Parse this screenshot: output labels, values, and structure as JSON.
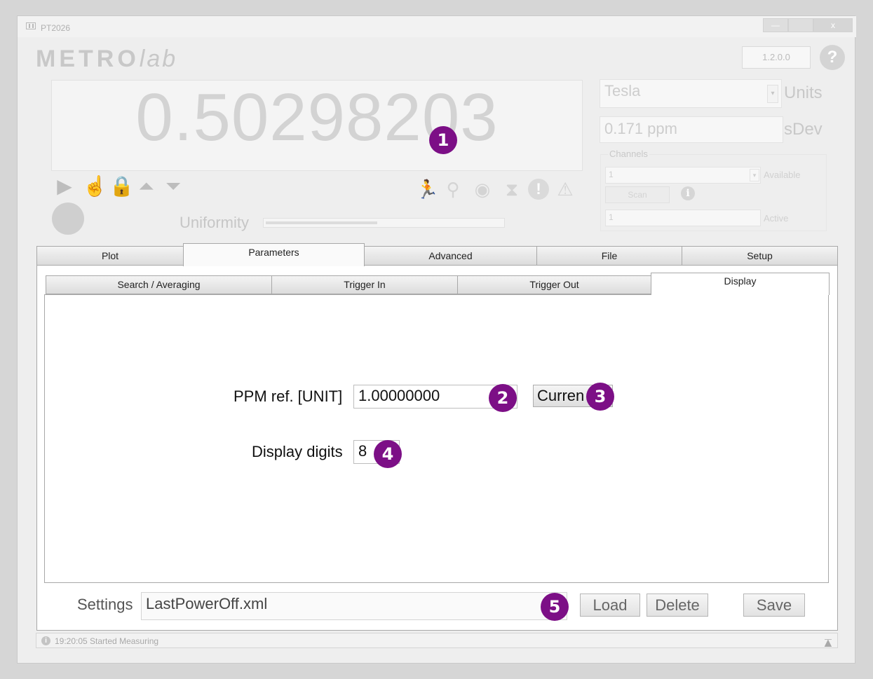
{
  "window": {
    "title": "PT2026",
    "min_button": "—",
    "close_button": "x"
  },
  "header": {
    "logo_bold": "METRO",
    "logo_italic": "lab",
    "version": "1.2.0.0",
    "help_icon": "question-mark-icon",
    "help_glyph": "?"
  },
  "reading": {
    "value": "0.50298203"
  },
  "controls_left": [
    {
      "name": "play-icon",
      "glyph": "▶"
    },
    {
      "name": "touch-hand-icon",
      "glyph": "☝"
    },
    {
      "name": "lock-icon",
      "glyph": "🔒"
    },
    {
      "name": "max-icon",
      "glyph": "⏶"
    },
    {
      "name": "min-icon",
      "glyph": "⏷"
    }
  ],
  "status_icons": [
    {
      "name": "running-man-icon",
      "glyph": "🏃"
    },
    {
      "name": "search-icon",
      "glyph": "⚲"
    },
    {
      "name": "gauge-icon",
      "glyph": "◉"
    },
    {
      "name": "hourglass-icon",
      "glyph": "⧗"
    },
    {
      "name": "alert-circle-icon",
      "glyph": "!"
    },
    {
      "name": "warning-triangle-icon",
      "glyph": "⚠"
    }
  ],
  "uniformity": {
    "label": "Uniformity",
    "level": 0.47
  },
  "units": {
    "value": "Tesla",
    "label": "Units"
  },
  "sdev": {
    "value": "0.171 ppm",
    "label": "sDev"
  },
  "channels": {
    "group_label": "Channels",
    "available_value": "1",
    "available_label": "Available",
    "scan_label": "Scan",
    "active_value": "1",
    "active_label": "Active"
  },
  "tabs": [
    "Plot",
    "Parameters",
    "Advanced",
    "File",
    "Setup"
  ],
  "active_tab": "Parameters",
  "subtabs": [
    "Search / Averaging",
    "Trigger In",
    "Trigger Out",
    "Display"
  ],
  "active_subtab": "Display",
  "display_panel": {
    "ppm_label": "PPM ref. [UNIT]",
    "ppm_value": "1.00000000",
    "current_button": "Curren",
    "digits_label": "Display digits",
    "digits_value": "8"
  },
  "settings": {
    "label": "Settings",
    "value": "LastPowerOff.xml",
    "load": "Load",
    "delete": "Delete",
    "save": "Save"
  },
  "status": {
    "text": "19:20:05 Started Measuring",
    "info_glyph": "i",
    "arrow_glyph": "▲"
  },
  "callouts": [
    "1",
    "2",
    "3",
    "4",
    "5"
  ],
  "colors": {
    "callout": "#7c0f86"
  }
}
